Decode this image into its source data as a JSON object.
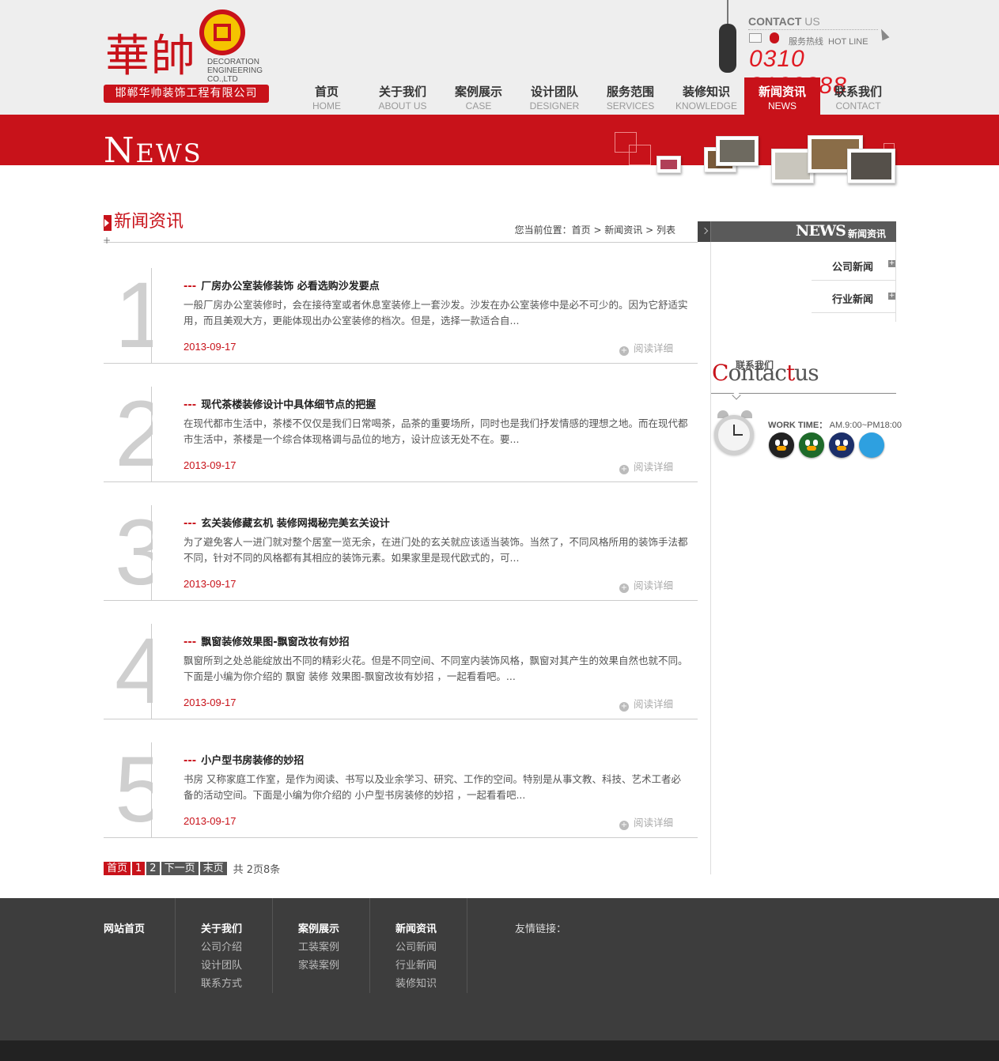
{
  "brand": {
    "logo_chars": "華帥",
    "logo_en_lines": [
      "DECORATION",
      "ENGINEERING",
      "CO.,LTD"
    ],
    "company_name": "邯郸华帅装饰工程有限公司"
  },
  "contact_box": {
    "title_bold": "CONTACT",
    "title_light": " US",
    "hotline_zh": "服务热线",
    "hotline_en": "HOT LINE",
    "phone": "0310 8133888"
  },
  "nav": [
    {
      "zh": "首页",
      "en": "HOME",
      "active": false
    },
    {
      "zh": "关于我们",
      "en": "ABOUT US",
      "active": false
    },
    {
      "zh": "案例展示",
      "en": "CASE",
      "active": false
    },
    {
      "zh": "设计团队",
      "en": "DESIGNER",
      "active": false
    },
    {
      "zh": "服务范围",
      "en": "SERVICES",
      "active": false
    },
    {
      "zh": "装修知识",
      "en": "KNOWLEDGE",
      "active": false
    },
    {
      "zh": "新闻资讯",
      "en": "NEWS",
      "active": true
    },
    {
      "zh": "联系我们",
      "en": "CONTACT",
      "active": false
    }
  ],
  "banner": {
    "title_big": "N",
    "title_small": "EWS"
  },
  "section": {
    "title": "新闻资讯",
    "breadcrumb": "您当前位置：首页 > 新闻资讯 > 列表"
  },
  "articles": [
    {
      "num": "1",
      "dash": "---",
      "title": "厂房办公室装修装饰 必看选购沙发要点",
      "desc": "一般厂房办公室装修时，会在接待室或者休息室装修上一套沙发。沙发在办公室装修中是必不可少的。因为它舒适实用，而且美观大方，更能体现出办公室装修的档次。但是，选择一款适合自...",
      "date": "2013-09-17",
      "more": "阅读详细"
    },
    {
      "num": "2",
      "dash": "---",
      "title": "现代茶楼装修设计中具体细节点的把握",
      "desc": "在现代都市生活中，茶楼不仅仅是我们日常喝茶，品茶的重要场所，同时也是我们抒发情感的理想之地。而在现代都市生活中，茶楼是一个综合体现格调与品位的地方，设计应该无处不在。要...",
      "date": "2013-09-17",
      "more": "阅读详细"
    },
    {
      "num": "3",
      "dash": "---",
      "title": "玄关装修藏玄机 装修网揭秘完美玄关设计",
      "desc": "为了避免客人一进门就对整个居室一览无余，在进门处的玄关就应该适当装饰。当然了，不同风格所用的装饰手法都不同，针对不同的风格都有其相应的装饰元素。如果家里是现代欧式的，可...",
      "date": "2013-09-17",
      "more": "阅读详细"
    },
    {
      "num": "4",
      "dash": "---",
      "title": "飘窗装修效果图-飘窗改妆有妙招",
      "desc": "飘窗所到之处总能绽放出不同的精彩火花。但是不同空间、不同室内装饰风格，飘窗对其产生的效果自然也就不同。下面是小编为你介绍的 飘窗 装修 效果图-飘窗改妆有妙招 ，一起看看吧。...",
      "date": "2013-09-17",
      "more": "阅读详细"
    },
    {
      "num": "5",
      "dash": "---",
      "title": "小户型书房装修的妙招",
      "desc": "书房 又称家庭工作室，是作为阅读、书写以及业余学习、研究、工作的空间。特别是从事文教、科技、艺术工者必备的活动空间。下面是小编为你介绍的 小户型书房装修的妙招 ，一起看看吧...",
      "date": "2013-09-17",
      "more": "阅读详细"
    }
  ],
  "pager": {
    "first": "首页",
    "page1": "1",
    "page2": "2",
    "next": "下一页",
    "last": "末页",
    "total": "共 2页8条"
  },
  "sidebar": {
    "head_en": "NEWS",
    "head_zh": "新闻资讯",
    "items": [
      {
        "label": "公司新闻"
      },
      {
        "label": "行业新闻"
      }
    ],
    "contact_zh": "联系我们",
    "contact_en_red1": "C",
    "contact_en_mid": "ontac",
    "contact_en_red2": "t",
    "contact_en_end": "us",
    "worktime_label": "WORK TIME：",
    "worktime_value": "AM.9:00~PM18:00"
  },
  "footer": {
    "cols": [
      {
        "title": "网站首页",
        "links": []
      },
      {
        "title": "关于我们",
        "links": [
          "公司介绍",
          "设计团队",
          "联系方式"
        ]
      },
      {
        "title": "案例展示",
        "links": [
          "工装案例",
          "家装案例"
        ]
      },
      {
        "title": "新闻资讯",
        "links": [
          "公司新闻",
          "行业新闻",
          "装修知识"
        ]
      }
    ],
    "friend_links": "友情链接："
  },
  "colors": {
    "brand_red": "#c8121a",
    "footer_bg": "#3d3d3d",
    "gold": "#f5c400"
  }
}
